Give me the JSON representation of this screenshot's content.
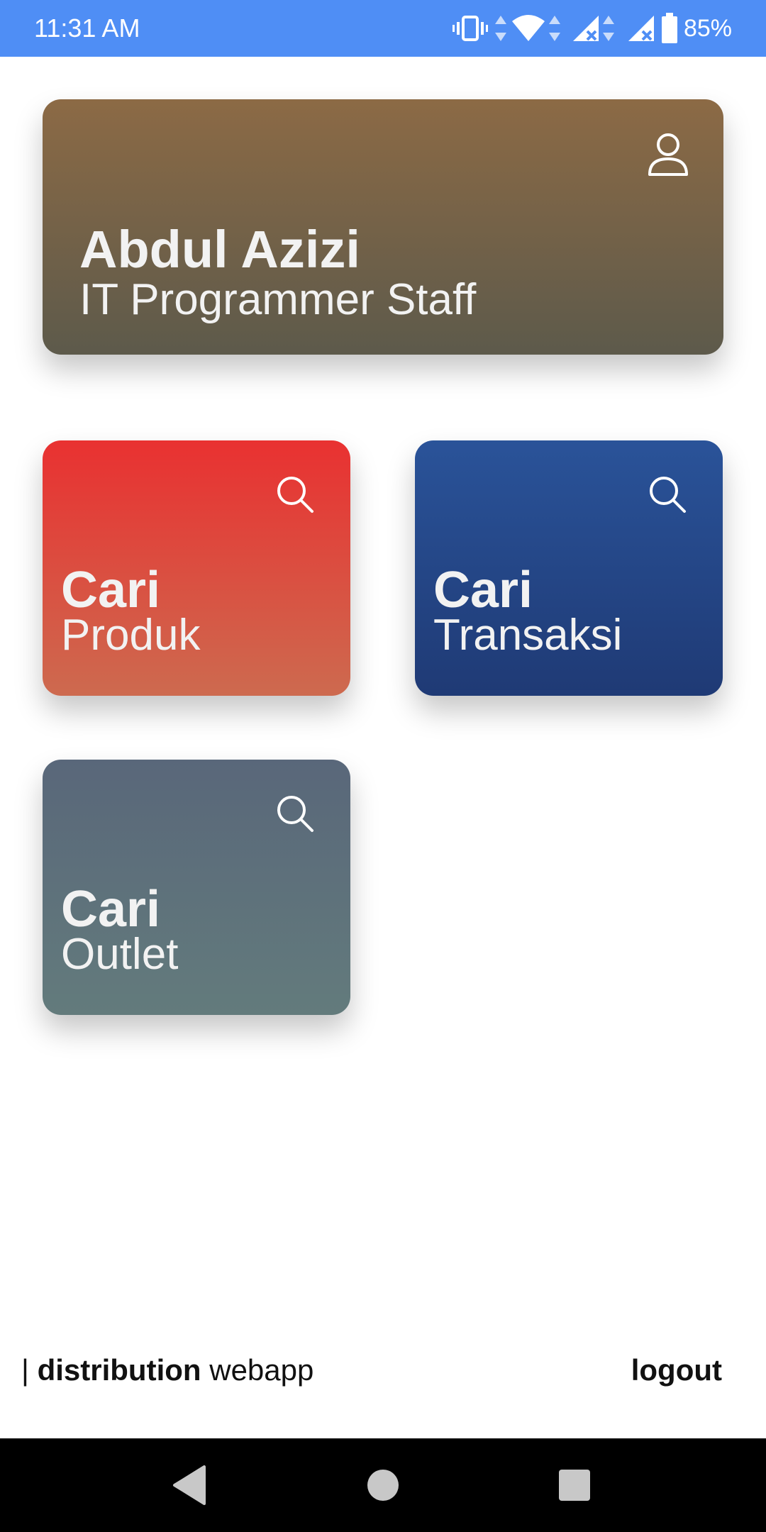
{
  "status_bar": {
    "time": "11:31 AM",
    "battery": "85%",
    "background_color": "#4f8ef5",
    "icons": [
      "vibrate-icon",
      "data-arrows-icon",
      "wifi-icon",
      "signal-no-service-icon",
      "signal-no-service-icon",
      "battery-icon"
    ]
  },
  "profile": {
    "name": "Abdul Azizi",
    "role": "IT Programmer Staff",
    "icon": "user-icon",
    "colors": [
      "#8c6a45",
      "#5d5a4b"
    ]
  },
  "tiles": [
    {
      "title": "Cari",
      "subtitle": "Produk",
      "icon": "search-icon",
      "colors": [
        "#e93131",
        "#cd6a4f"
      ]
    },
    {
      "title": "Cari",
      "subtitle": "Transaksi",
      "icon": "search-icon",
      "colors": [
        "#2a5399",
        "#1f3a75"
      ]
    },
    {
      "title": "Cari",
      "subtitle": "Outlet",
      "icon": "search-icon",
      "colors": [
        "#59677a",
        "#637b7c"
      ]
    }
  ],
  "footer": {
    "brand_prefix": "| ",
    "brand_bold": "distribution",
    "brand_rest": " webapp",
    "logout_label": "logout"
  },
  "nav_bar": {
    "buttons": [
      "back-icon",
      "home-icon",
      "recents-icon"
    ]
  }
}
